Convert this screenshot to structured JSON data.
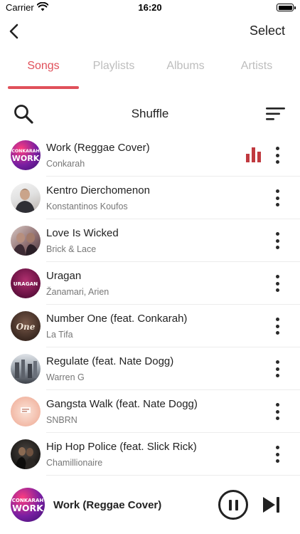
{
  "status_bar": {
    "carrier": "Carrier",
    "time": "16:20"
  },
  "nav": {
    "select_label": "Select"
  },
  "tabs": [
    {
      "label": "Songs",
      "active": true
    },
    {
      "label": "Playlists",
      "active": false
    },
    {
      "label": "Albums",
      "active": false
    },
    {
      "label": "Artists",
      "active": false
    }
  ],
  "toolbar": {
    "shuffle_label": "Shuffle"
  },
  "songs": [
    {
      "title": "Work (Reggae Cover)",
      "artist": "Conkarah",
      "playing": true,
      "art_text": "CONKARAH\nWORK"
    },
    {
      "title": "Kentro Dierchomenon",
      "artist": "Konstantinos Koufos",
      "playing": false,
      "art_text": ""
    },
    {
      "title": "Love Is Wicked",
      "artist": "Brick & Lace",
      "playing": false,
      "art_text": ""
    },
    {
      "title": "Uragan",
      "artist": "Žanamari, Arien",
      "playing": false,
      "art_text": "URAGAN"
    },
    {
      "title": "Number One (feat. Conkarah)",
      "artist": "La Tifa",
      "playing": false,
      "art_text": "One"
    },
    {
      "title": "Regulate (feat. Nate Dogg)",
      "artist": "Warren G",
      "playing": false,
      "art_text": ""
    },
    {
      "title": "Gangsta Walk (feat. Nate Dogg)",
      "artist": "SNBRN",
      "playing": false,
      "art_text": ""
    },
    {
      "title": "Hip Hop Police (feat. Slick Rick)",
      "artist": "Chamillionaire",
      "playing": false,
      "art_text": ""
    }
  ],
  "mini_player": {
    "title": "Work (Reggae Cover)",
    "art_text": "CONKARAH\nWORK",
    "state": "playing"
  },
  "colors": {
    "accent": "#e0505a",
    "eq_icon": "#c0393f",
    "inactive_tab": "#bdbdbd"
  },
  "icons": {
    "back": "chevron-left-icon",
    "search": "search-icon",
    "sort": "sort-icon",
    "more": "more-vertical-icon",
    "playing": "equalizer-icon",
    "pause": "pause-icon",
    "next": "skip-next-icon"
  }
}
